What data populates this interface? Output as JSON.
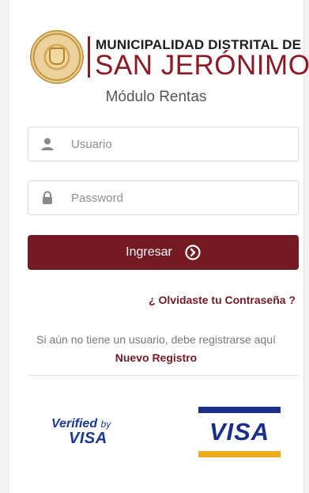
{
  "header": {
    "org_line1": "MUNICIPALIDAD DISTRITAL DE",
    "org_line2": "SAN JERÓNIMO",
    "module_title": "Módulo Rentas"
  },
  "login": {
    "username_placeholder": "Usuario",
    "password_placeholder": "Password",
    "submit_label": "Ingresar",
    "forgot_link": "¿ Olvidaste tu Contraseña ?"
  },
  "register": {
    "prompt": "Si aún no tiene un usuario, debe registrarse aquí",
    "link": "Nuevo Registro"
  },
  "payments": {
    "verified_by_line1": "Verified",
    "verified_by_by": "by",
    "verified_by_line2": "VISA",
    "visa_word": "VISA"
  },
  "colors": {
    "brand": "#731a22",
    "visa_blue": "#1a2f8a",
    "visa_gold": "#f0ac1b"
  }
}
